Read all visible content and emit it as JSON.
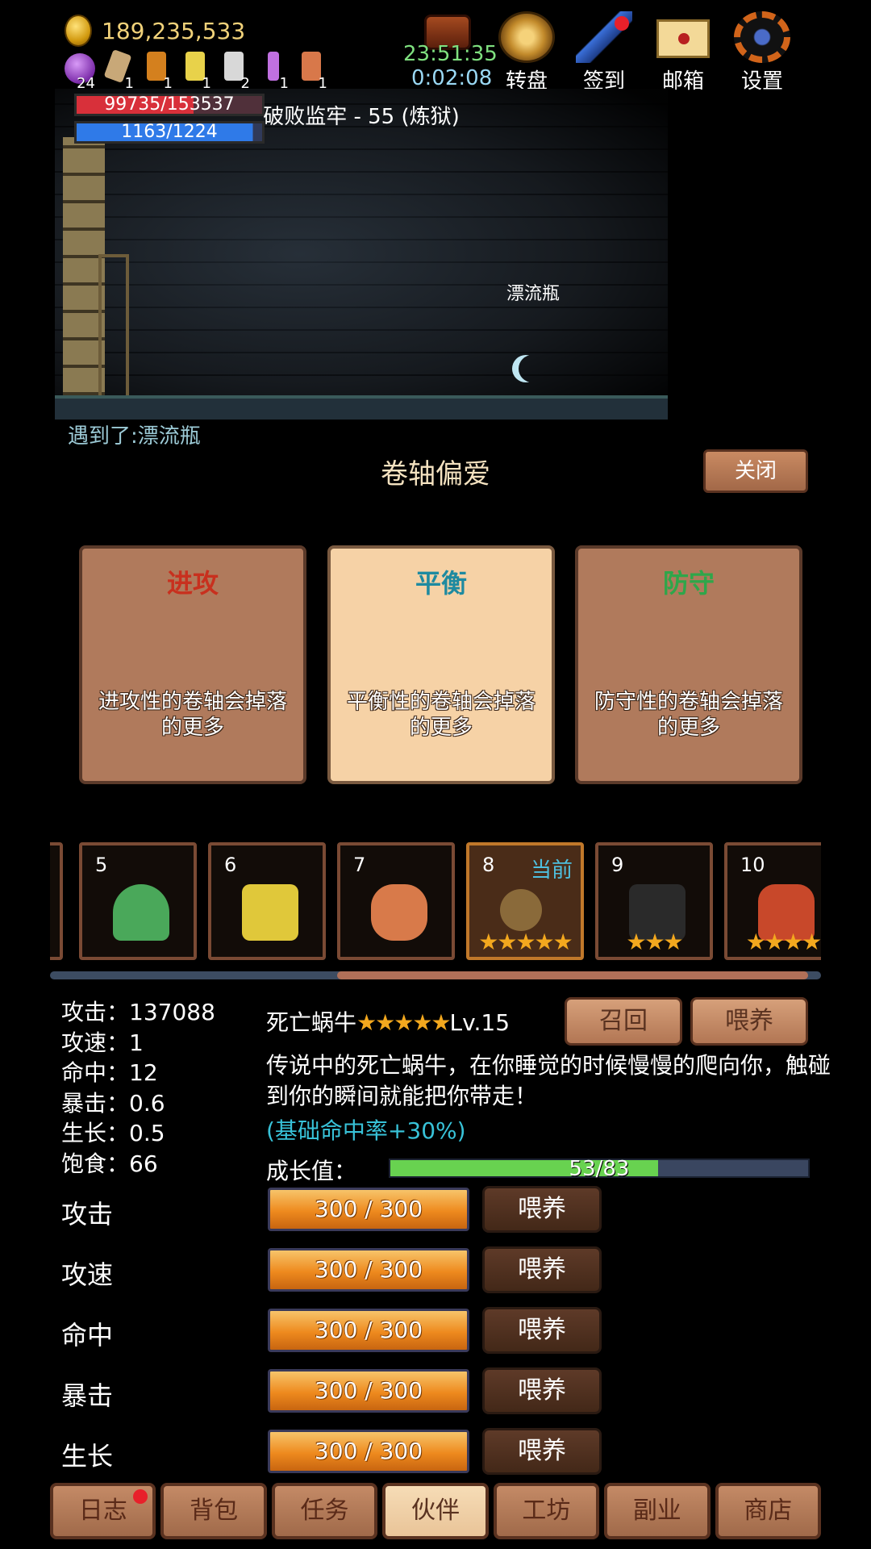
{
  "hud": {
    "gold": "189,235,533",
    "items": [
      {
        "icon": "purple-orb-icon",
        "count": "24"
      },
      {
        "icon": "scroll-icon-1",
        "count": "1"
      },
      {
        "icon": "scroll-icon-2",
        "count": "1"
      },
      {
        "icon": "scroll-icon-3",
        "count": "1"
      },
      {
        "icon": "scroll-icon-4",
        "count": "2"
      },
      {
        "icon": "scroll-icon-5",
        "count": "1"
      },
      {
        "icon": "scroll-icon-6",
        "count": "1"
      }
    ],
    "clock": "23:51:35",
    "timer": "0:02:08",
    "buttons": {
      "wheel": "转盘",
      "signin": "签到",
      "mail": "邮箱",
      "settings": "设置"
    }
  },
  "scene": {
    "hp": "99735/153537",
    "mp": "1163/1224",
    "area": "破败监牢 - 55 (炼狱)",
    "object_label": "漂流瓶",
    "encounter": "遇到了:漂流瓶"
  },
  "preference": {
    "title": "卷轴偏爱",
    "close": "关闭",
    "cards": [
      {
        "title": "进攻",
        "desc": "进攻性的卷轴会掉落的更多",
        "color": "#c8301e"
      },
      {
        "title": "平衡",
        "desc": "平衡性的卷轴会掉落的更多",
        "color": "#1e8aa0"
      },
      {
        "title": "防守",
        "desc": "防守性的卷轴会掉落的更多",
        "color": "#2fa64a"
      }
    ]
  },
  "companions": {
    "current_label": "当前",
    "slots": [
      {
        "num": "5",
        "stars": ""
      },
      {
        "num": "6",
        "stars": ""
      },
      {
        "num": "7",
        "stars": ""
      },
      {
        "num": "8",
        "stars": "★★★★★"
      },
      {
        "num": "9",
        "stars": "★★★"
      },
      {
        "num": "10",
        "stars": "★★★★"
      }
    ]
  },
  "stats": [
    "攻击：137088",
    "攻速：1",
    "命中：12",
    "暴击：0.6",
    "生长：0.5",
    "饱食：66"
  ],
  "pet": {
    "name": "死亡蜗牛",
    "stars": "★★★★★",
    "level": "Lv.15",
    "recall": "召回",
    "feed": "喂养",
    "desc": "传说中的死亡蜗牛，在你睡觉的时候慢慢的爬向你，触碰到你的瞬间就能把你带走！",
    "bonus": "(基础命中率+30%)",
    "growth_label": "成长值：",
    "growth_text": "53/83",
    "growth_fraction": 0.64
  },
  "feed_rows": [
    {
      "name": "攻击",
      "value": "300 / 300",
      "button": "喂养"
    },
    {
      "name": "攻速",
      "value": "300 / 300",
      "button": "喂养"
    },
    {
      "name": "命中",
      "value": "300 / 300",
      "button": "喂养"
    },
    {
      "name": "暴击",
      "value": "300 / 300",
      "button": "喂养"
    },
    {
      "name": "生长",
      "value": "300 / 300",
      "button": "喂养"
    }
  ],
  "nav": [
    "日志",
    "背包",
    "任务",
    "伙伴",
    "工坊",
    "副业",
    "商店"
  ]
}
